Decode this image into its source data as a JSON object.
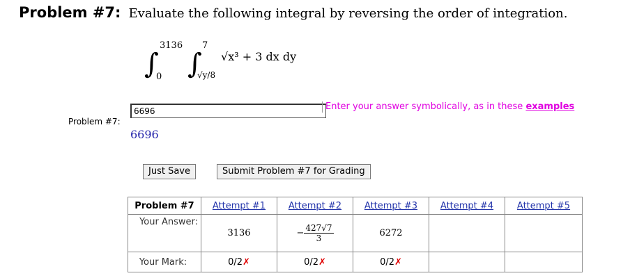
{
  "problem": {
    "number_label": "Problem #7:",
    "instruction": "Evaluate the following integral by reversing the order of integration."
  },
  "integral": {
    "outer_upper": "3136",
    "outer_lower": "0",
    "inner_upper": "7",
    "inner_lower": "√y/8",
    "integrand": "√x³ + 3 dx dy"
  },
  "answer": {
    "row_label": "Problem #7:",
    "input_value": "6696",
    "hint_text": "Enter your answer symbolically, as in these",
    "hint_link": "examples",
    "preview": "6696"
  },
  "buttons": {
    "save": "Just Save",
    "submit": "Submit Problem #7 for Grading"
  },
  "attempts": {
    "header": "Problem #7",
    "answer_label": "Your Answer:",
    "mark_label": "Your Mark:",
    "columns": [
      "Attempt #1",
      "Attempt #2",
      "Attempt #3",
      "Attempt #4",
      "Attempt #5"
    ],
    "answers": [
      "3136",
      "",
      "6272",
      "",
      ""
    ],
    "attempt2_num": "427√7",
    "attempt2_den": "3",
    "attempt2_sign": "−",
    "marks": [
      "0/2",
      "0/2",
      "0/2",
      "",
      ""
    ],
    "wrong_symbol": "✗"
  }
}
